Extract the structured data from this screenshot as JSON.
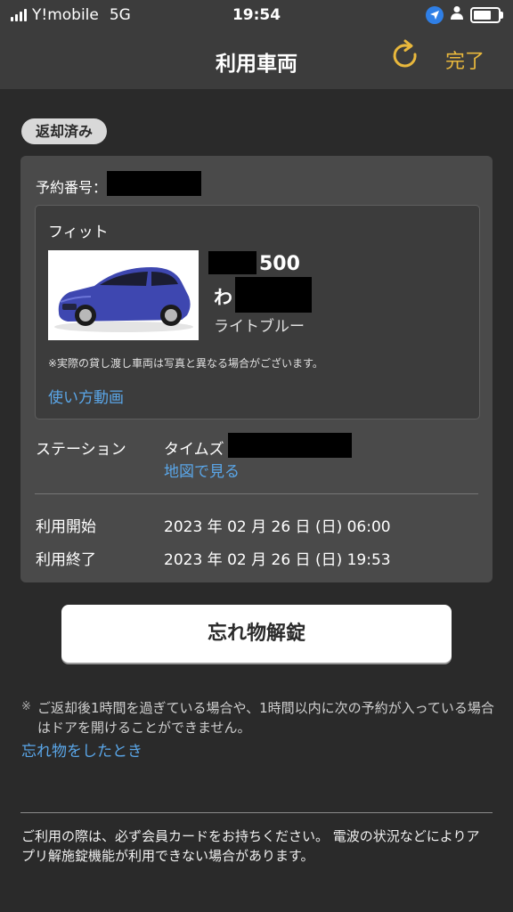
{
  "status_bar": {
    "carrier": "Y!mobile",
    "network": "5G",
    "time": "19:54",
    "battery_level": 0.85
  },
  "header": {
    "title": "利用車両",
    "done_label": "完了",
    "accent_color": "#e9b83c"
  },
  "status_badge": "返却済み",
  "reservation": {
    "label": "予約番号："
  },
  "vehicle": {
    "model": "フィット",
    "plate_number": "500",
    "plate_kana": "わ",
    "color": "ライトブルー",
    "photo_note": "※実際の貸し渡し車両は写真と異なる場合がございます。",
    "howto_link": "使い方動画"
  },
  "station": {
    "label": "ステーション",
    "name": "タイムズ",
    "map_link": "地図で見る"
  },
  "usage": {
    "start_label": "利用開始",
    "start_value": "2023 年 02 月 26 日 (日) 06:00",
    "end_label": "利用終了",
    "end_value": "2023 年 02 月 26 日 (日) 19:53"
  },
  "unlock_button": "忘れ物解錠",
  "notice": {
    "mark": "※",
    "text": "ご返却後1時間を過ぎている場合や、1時間以内に次の予約が入っている場合はドアを開けることができません。",
    "link": "忘れ物をしたとき"
  },
  "footer": {
    "text": "ご利用の際は、必ず会員カードをお持ちください。 電波の状況などによりアプリ解施錠機能が利用できない場合があります。"
  },
  "icons": [
    "signal-icon",
    "location-arrow-icon",
    "person-icon",
    "battery-icon",
    "refresh-icon",
    "car-photo"
  ]
}
